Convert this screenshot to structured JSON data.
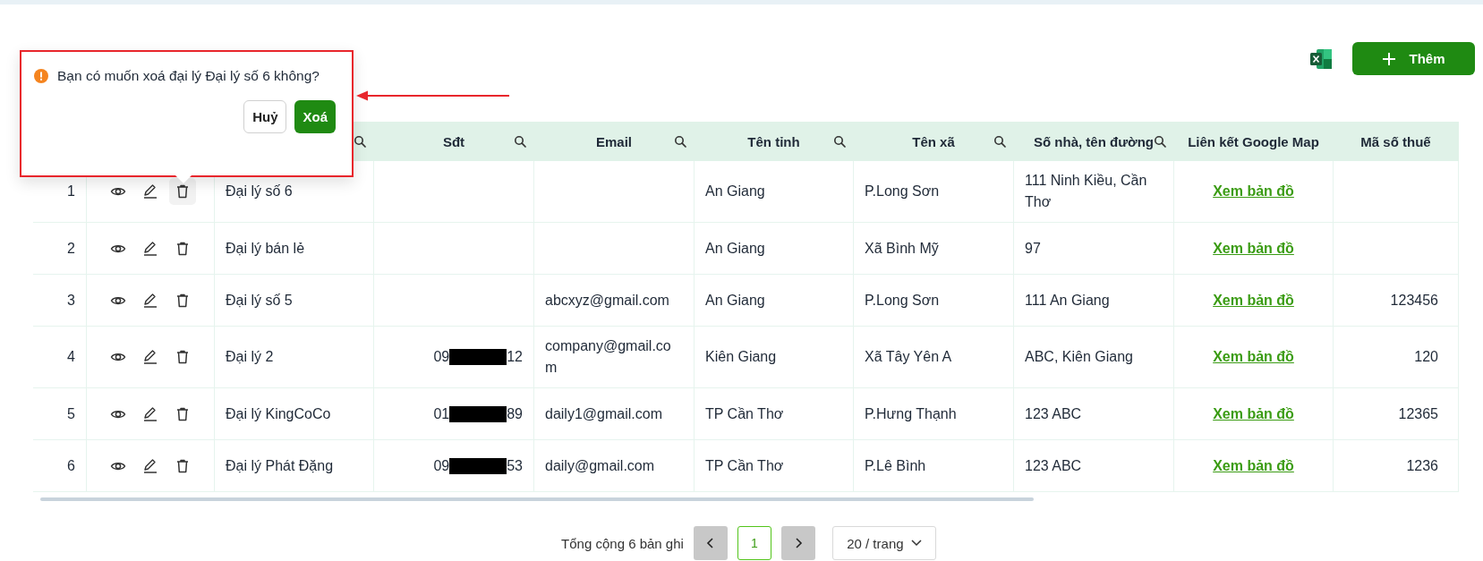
{
  "toolbar": {
    "add_button": {
      "label": "Thêm"
    }
  },
  "table": {
    "columns": [
      {},
      {},
      {
        "searchable": true
      },
      {
        "label": "Sđt",
        "searchable": true
      },
      {
        "label": "Email",
        "searchable": true
      },
      {
        "label": "Tên tỉnh",
        "searchable": true
      },
      {
        "label": "Tên xã",
        "searchable": true
      },
      {
        "label": "Số nhà, tên đường",
        "searchable": true
      },
      {
        "label": "Liên kết Google Map",
        "searchable": false
      },
      {
        "label": "Mã số thuế",
        "searchable": false
      }
    ],
    "rows": [
      {
        "index": "1",
        "delete_hover": true,
        "name": "Đại lý số 6",
        "province": "An Giang",
        "ward": "P.Long Sơn",
        "address": "111 Ninh Kiều, Cần Thơ",
        "map_link": "Xem bản đồ"
      },
      {
        "index": "2",
        "delete_hover": false,
        "name": "Đại lý bán lẻ",
        "province": "An Giang",
        "ward": "Xã Bình Mỹ",
        "address": "97",
        "map_link": "Xem bản đồ"
      },
      {
        "index": "3",
        "delete_hover": false,
        "name": "Đại lý số 5",
        "email": "abcxyz@gmail.com",
        "province": "An Giang",
        "ward": "P.Long Sơn",
        "address": "111 An Giang",
        "map_link": "Xem bản đồ",
        "tax_code": "123456"
      },
      {
        "index": "4",
        "delete_hover": false,
        "name": "Đại lý 2",
        "phone": {
          "start": "09",
          "end": "12"
        },
        "email": "company@gmail.com",
        "province": "Kiên Giang",
        "ward": "Xã Tây Yên A",
        "address": "ABC, Kiên Giang",
        "map_link": "Xem bản đồ",
        "tax_code": "120"
      },
      {
        "index": "5",
        "delete_hover": false,
        "name": "Đại lý KingCoCo",
        "phone": {
          "start": "01",
          "end": "89"
        },
        "email": "daily1@gmail.com",
        "province": "TP Cần Thơ",
        "ward": "P.Hưng Thạnh",
        "address": "123 ABC",
        "map_link": "Xem bản đồ",
        "tax_code": "12365"
      },
      {
        "index": "6",
        "delete_hover": false,
        "name": "Đại lý Phát Đặng",
        "phone": {
          "start": "09",
          "end": "53"
        },
        "email": "daily@gmail.com",
        "province": "TP Cần Thơ",
        "ward": "P.Lê Bình",
        "address": "123 ABC",
        "map_link": "Xem bản đồ",
        "tax_code": "1236"
      }
    ]
  },
  "pagination": {
    "total": "Tổng cộng 6 bản ghi",
    "pages": [
      {
        "label": "1",
        "selected": true
      }
    ],
    "page_size": "20 / trang"
  },
  "confirm_popup": {
    "message": "Bạn có muốn xoá đại lý Đại lý số 6 không?",
    "cancel": "Huỷ",
    "confirm": "Xoá"
  }
}
